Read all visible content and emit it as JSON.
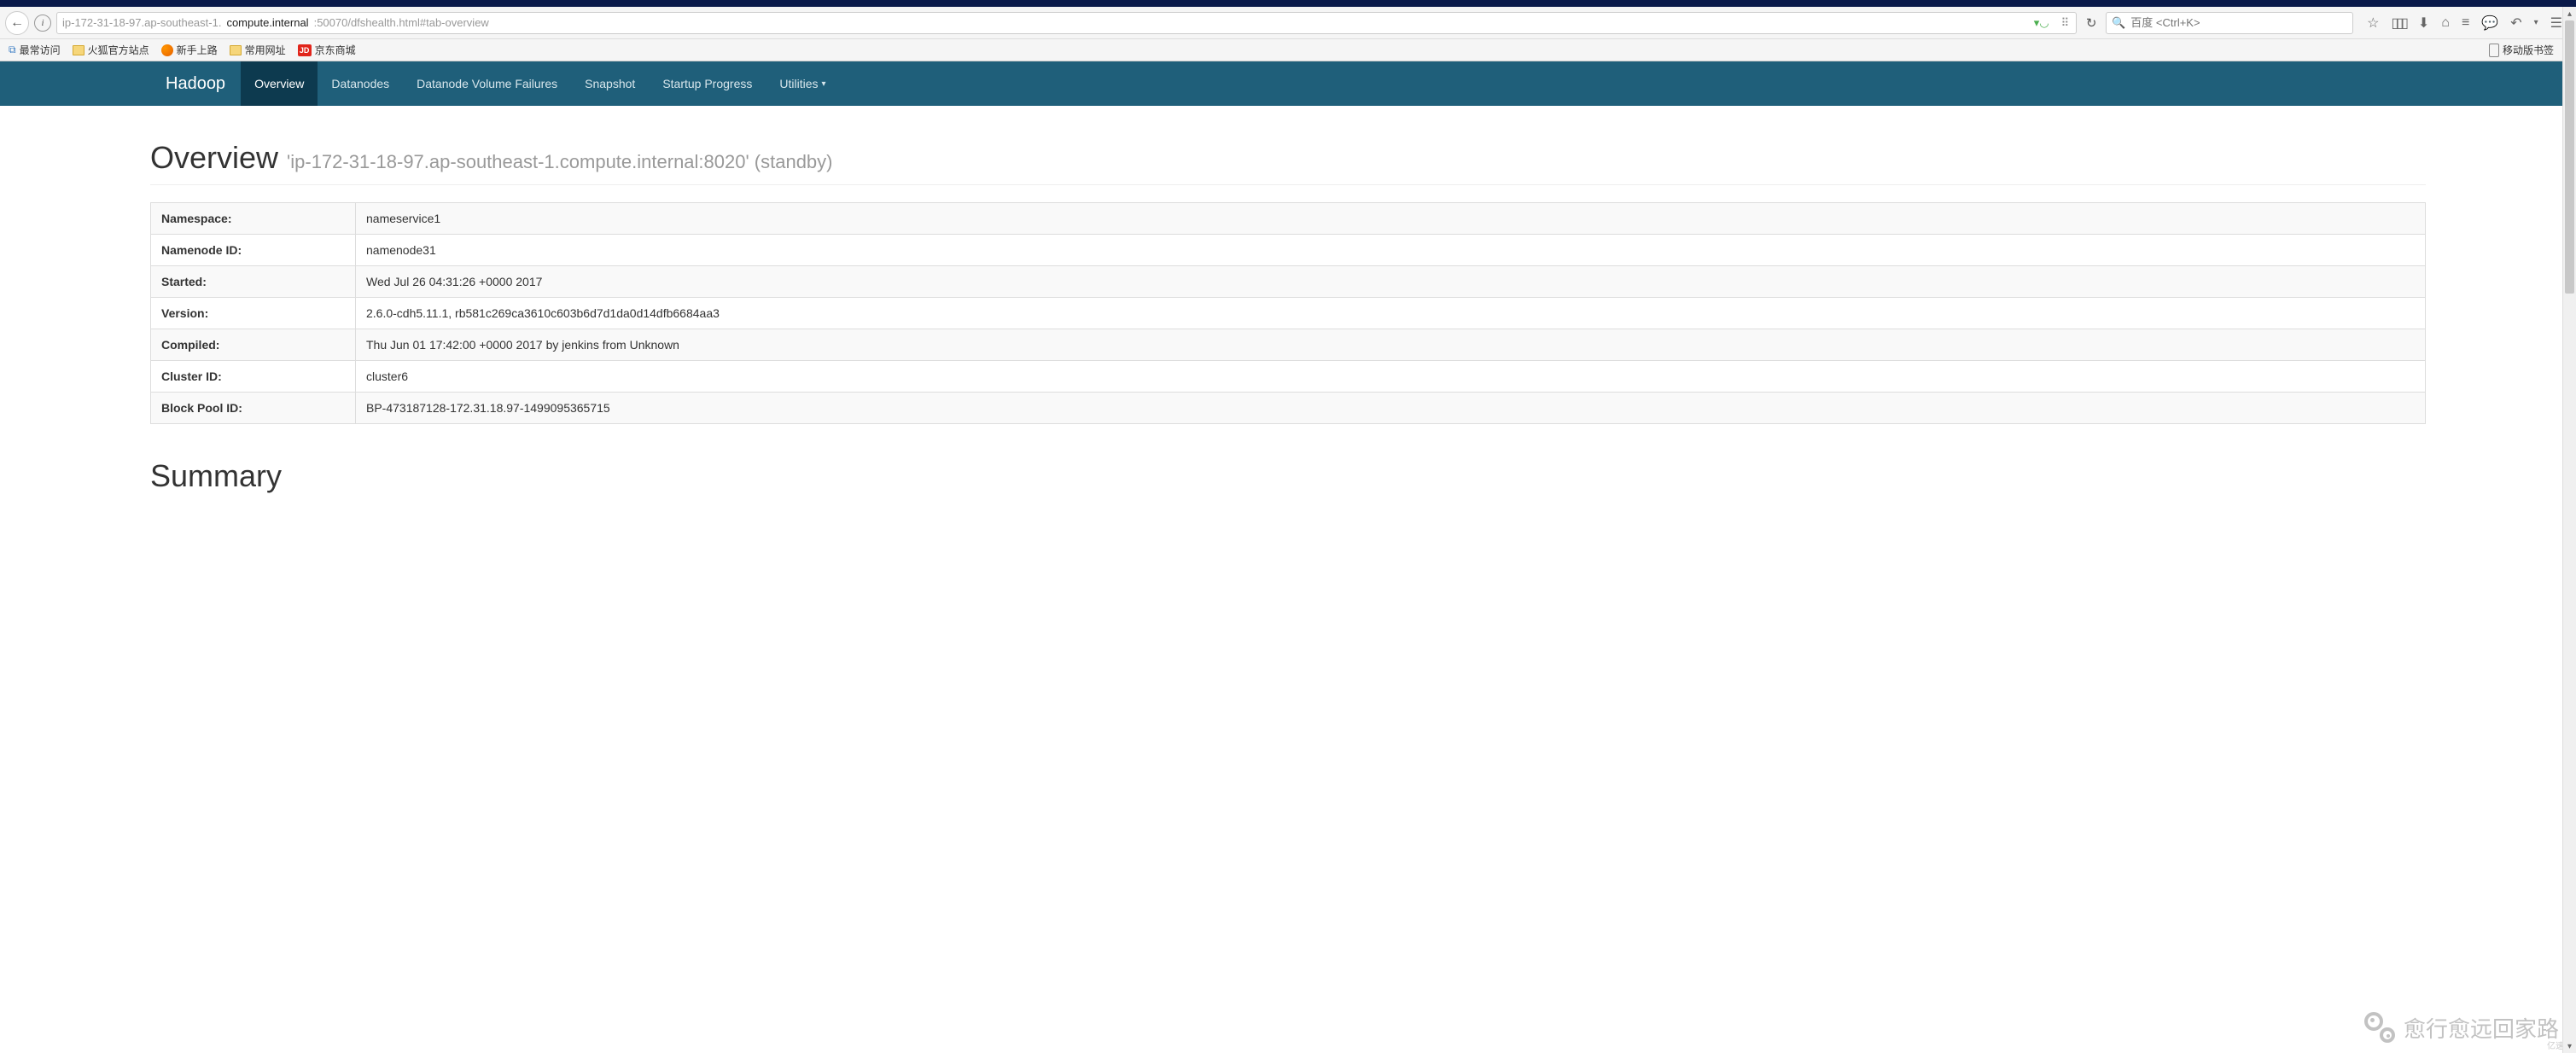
{
  "browser": {
    "url_pre": "ip-172-31-18-97.ap-southeast-1.",
    "url_bold": "compute.internal",
    "url_post": ":50070/dfshealth.html#tab-overview",
    "search_placeholder": "百度 <Ctrl+K>"
  },
  "bookmarks": {
    "most_visited": "最常访问",
    "firefox_official": "火狐官方站点",
    "getting_started": "新手上路",
    "common_sites": "常用网址",
    "jd_badge": "JD",
    "jd_label": "京东商城",
    "mobile_bookmarks": "移动版书签"
  },
  "nav": {
    "brand": "Hadoop",
    "items": [
      "Overview",
      "Datanodes",
      "Datanode Volume Failures",
      "Snapshot",
      "Startup Progress",
      "Utilities"
    ]
  },
  "page": {
    "heading": "Overview",
    "subheading": "'ip-172-31-18-97.ap-southeast-1.compute.internal:8020' (standby)",
    "summary_heading": "Summary",
    "rows": [
      {
        "label": "Namespace:",
        "value": "nameservice1"
      },
      {
        "label": "Namenode ID:",
        "value": "namenode31"
      },
      {
        "label": "Started:",
        "value": "Wed Jul 26 04:31:26 +0000 2017"
      },
      {
        "label": "Version:",
        "value": "2.6.0-cdh5.11.1, rb581c269ca3610c603b6d7d1da0d14dfb6684aa3"
      },
      {
        "label": "Compiled:",
        "value": "Thu Jun 01 17:42:00 +0000 2017 by jenkins from Unknown"
      },
      {
        "label": "Cluster ID:",
        "value": "cluster6"
      },
      {
        "label": "Block Pool ID:",
        "value": "BP-473187128-172.31.18.97-1499095365715"
      }
    ]
  },
  "watermark": {
    "text": "愈行愈远回家路",
    "corner": "亿速云"
  }
}
